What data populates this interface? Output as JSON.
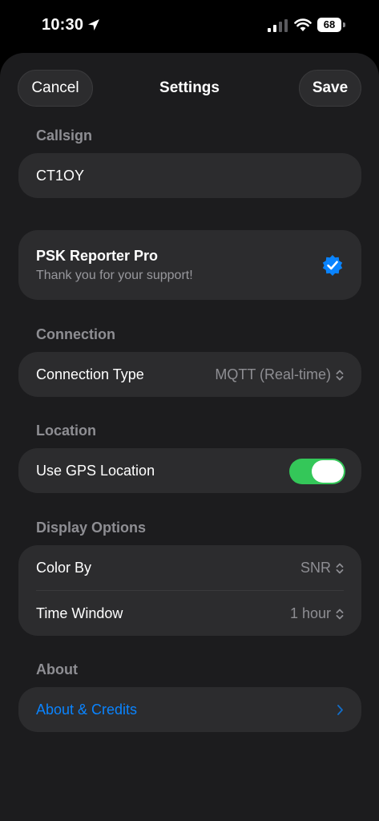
{
  "status_bar": {
    "time": "10:30",
    "battery": "68"
  },
  "nav": {
    "cancel_label": "Cancel",
    "title": "Settings",
    "save_label": "Save"
  },
  "callsign": {
    "section_label": "Callsign",
    "value": "CT1OY"
  },
  "pro": {
    "title": "PSK Reporter Pro",
    "subtitle": "Thank you for your support!"
  },
  "connection": {
    "section_label": "Connection",
    "type_label": "Connection Type",
    "type_value": "MQTT (Real-time)"
  },
  "location": {
    "section_label": "Location",
    "gps_label": "Use GPS Location",
    "gps_enabled": true
  },
  "display": {
    "section_label": "Display Options",
    "color_by_label": "Color By",
    "color_by_value": "SNR",
    "time_window_label": "Time Window",
    "time_window_value": "1 hour"
  },
  "about": {
    "section_label": "About",
    "link_label": "About & Credits"
  },
  "colors": {
    "accent": "#0a84ff",
    "toggle_on": "#34c759",
    "sheet_bg": "#1c1c1e",
    "group_bg": "#2c2c2e"
  }
}
